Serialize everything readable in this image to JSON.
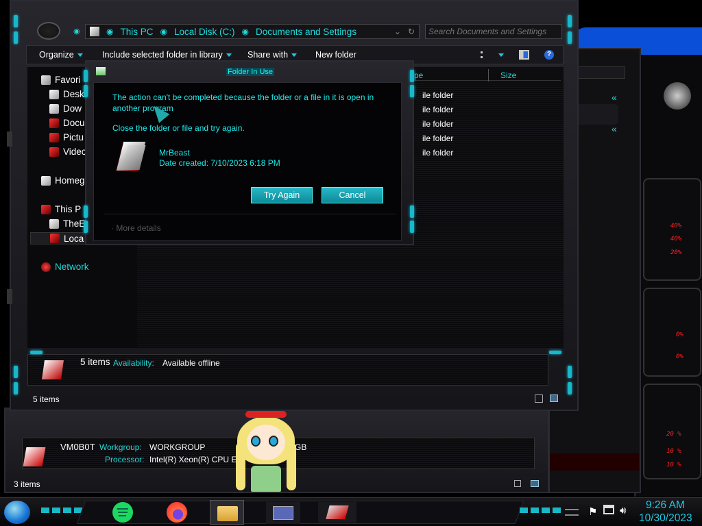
{
  "explorer": {
    "address": {
      "crumbs": [
        "This PC",
        "Local Disk (C:)",
        "Documents and Settings"
      ],
      "search_placeholder": "Search Documents and Settings"
    },
    "toolbar": {
      "organize": "Organize",
      "include": "Include selected folder in library",
      "share": "Share with",
      "new_folder": "New folder"
    },
    "nav": {
      "favorites": "Favori",
      "desktop": "Desk",
      "downloads": "Dow",
      "documents": "Docu",
      "pictures": "Pictu",
      "videos": "Video",
      "homegroup": "Homeg",
      "this_pc": "This P",
      "user": "TheE",
      "local": "Loca",
      "network": "Network"
    },
    "columns": {
      "type": "pe",
      "size": "Size"
    },
    "rows": [
      "ile folder",
      "ile folder",
      "ile folder",
      "ile folder",
      "ile folder"
    ],
    "details": {
      "count": "5 items",
      "avail_label": "Availability:",
      "avail_value": "Available offline"
    },
    "status": "5 items"
  },
  "dialog": {
    "title": "Folder In Use",
    "message": "The action can't be completed because the folder or a file in it is open in another program",
    "hint": "Close the folder or file and try again.",
    "file_name": "MrBeast",
    "file_date": "Date created: 7/10/2023 6:18 PM",
    "try_again": "Try Again",
    "cancel": "Cancel",
    "more_details": "More details"
  },
  "back_window": {
    "computer": "VM0B0T",
    "workgroup_label": "Workgroup:",
    "workgroup": "WORKGROUP",
    "memory_label": "M",
    "memory_value": "GB",
    "processor_label": "Processor:",
    "processor": "Intel(R) Xeon(R) CPU E...",
    "status": "3 items"
  },
  "widget": {
    "percents": [
      "40%",
      "40%",
      "20%",
      "0%",
      "0%",
      "20 %",
      "10 %",
      "10 %"
    ]
  },
  "taskbar": {
    "time": "9:26 AM",
    "date": "10/30/2023"
  }
}
